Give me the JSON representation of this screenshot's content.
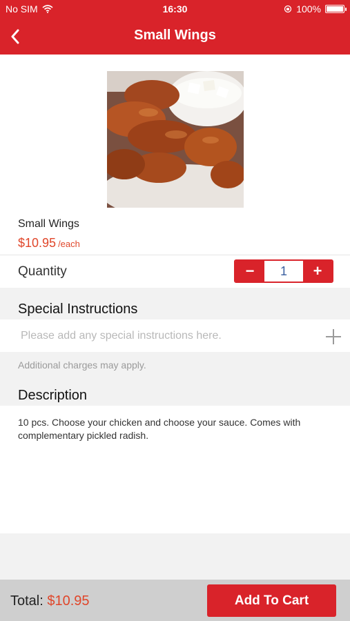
{
  "status_bar": {
    "carrier": "No SIM",
    "time": "16:30",
    "battery": "100%",
    "icons": [
      "wifi-icon",
      "orientation-lock-icon",
      "battery-icon"
    ]
  },
  "nav": {
    "title": "Small Wings",
    "back_icon": "chevron-left-icon"
  },
  "item": {
    "name": "Small Wings",
    "price": "$10.95",
    "unit": "/each"
  },
  "quantity": {
    "label": "Quantity",
    "minus": "−",
    "value": "1",
    "plus": "+"
  },
  "special_instructions": {
    "heading": "Special Instructions",
    "placeholder": "Please add any special instructions here.",
    "value": "",
    "add_icon": "plus-icon",
    "note": "Additional charges may apply."
  },
  "description": {
    "heading": "Description",
    "text": "10 pcs. Choose your chicken and choose your sauce. Comes with complementary pickled radish."
  },
  "footer": {
    "total_label": "Total:",
    "total_value": "$10.95",
    "cart_button": "Add To Cart"
  },
  "colors": {
    "brand_red": "#d9232a",
    "price_orange": "#e0462a"
  }
}
